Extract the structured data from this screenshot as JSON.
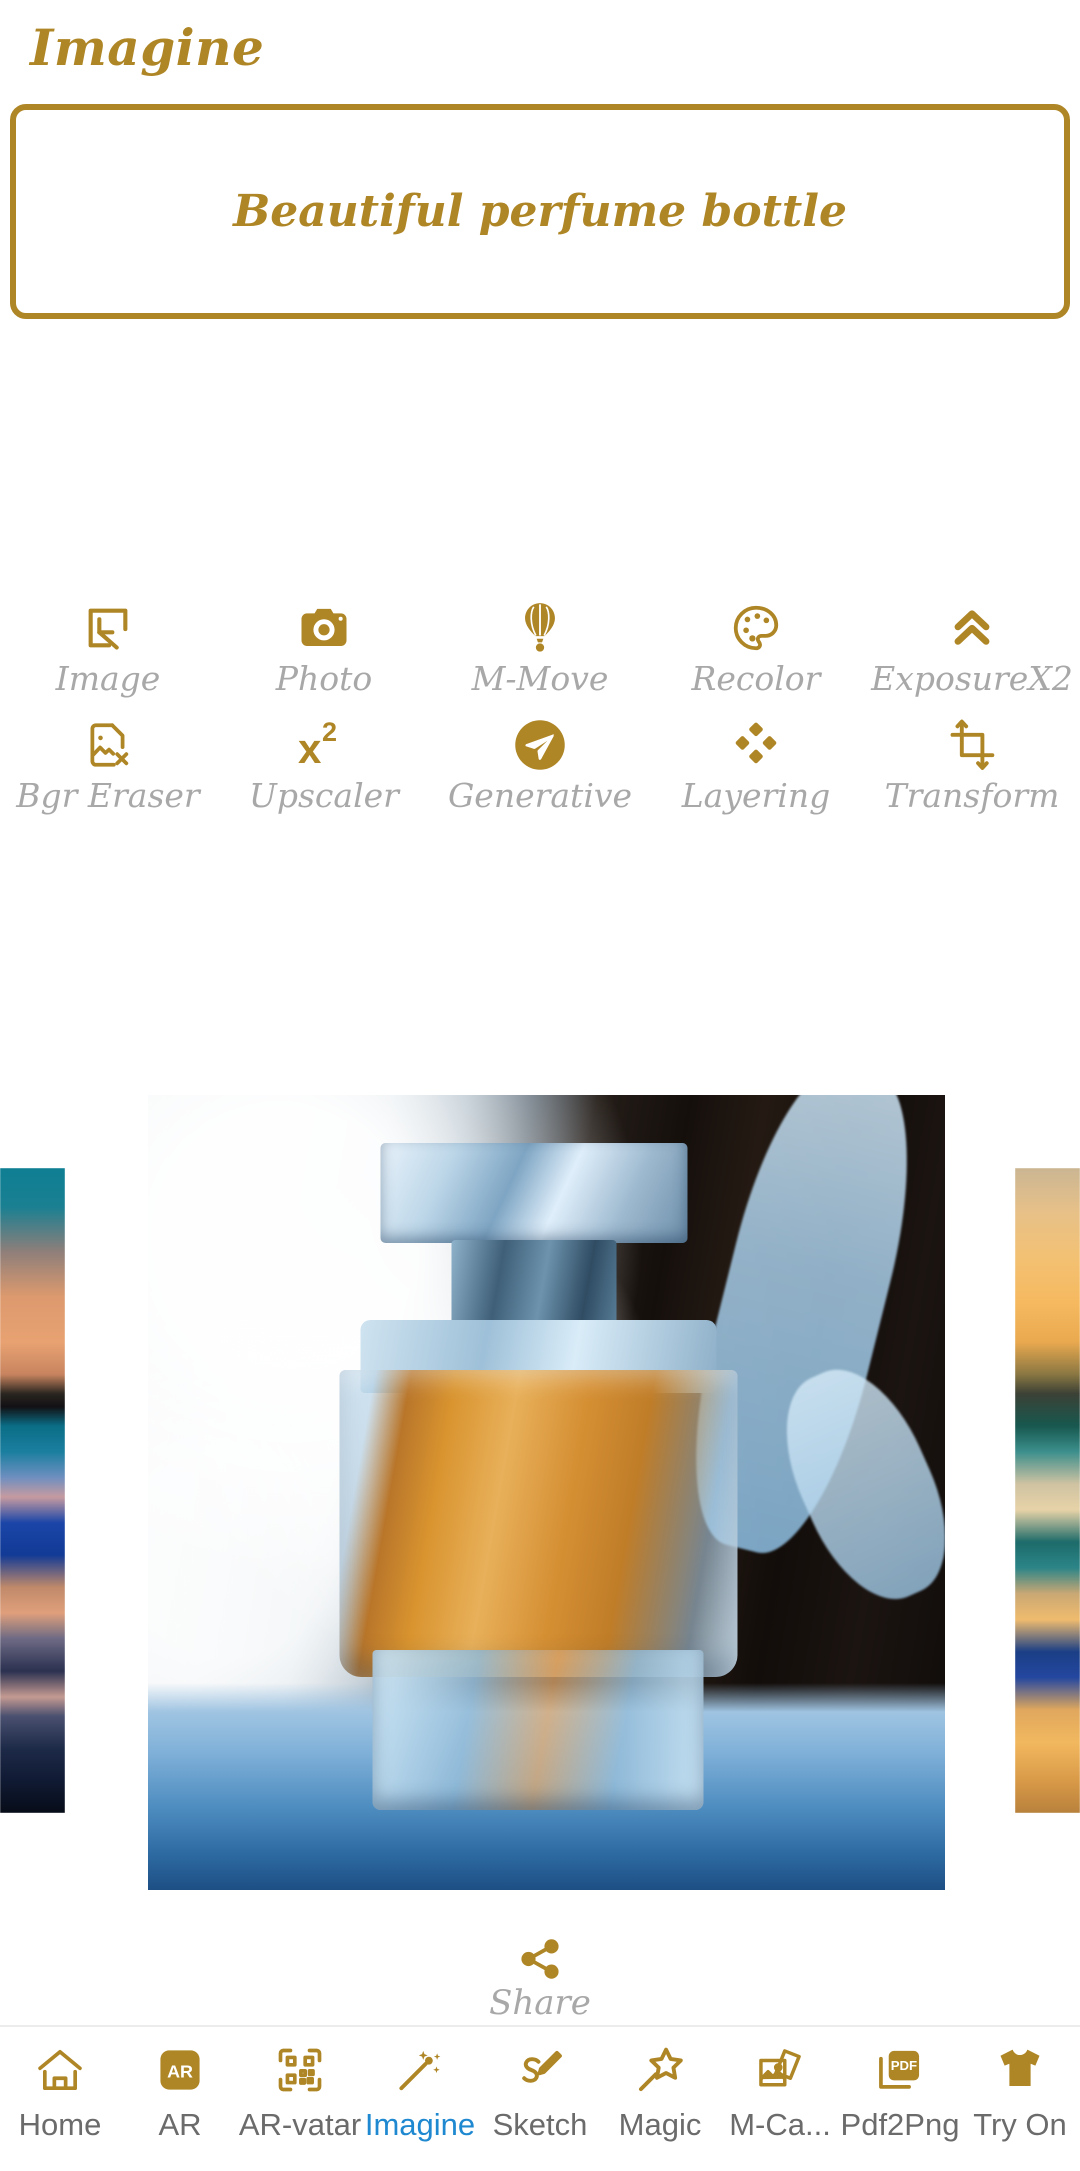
{
  "header": {
    "title": "Imagine"
  },
  "prompt": {
    "value": "Beautiful perfume bottle",
    "placeholder": "Beautiful perfume bottle"
  },
  "colors": {
    "gold": "#AF8626",
    "label_gray": "#A8A8A8",
    "nav_gray": "#6B6B6B",
    "active_blue": "#1E88D0"
  },
  "tools": {
    "row1": [
      {
        "label": "Image",
        "icon": "image-select-icon"
      },
      {
        "label": "Photo",
        "icon": "camera-icon"
      },
      {
        "label": "M-Move",
        "icon": "hot-air-balloon-icon"
      },
      {
        "label": "Recolor",
        "icon": "palette-icon"
      },
      {
        "label": "ExposureX2",
        "icon": "double-chevron-up-icon"
      }
    ],
    "row2": [
      {
        "label": "Bgr Eraser",
        "icon": "image-remove-icon"
      },
      {
        "label": "Upscaler",
        "icon": "x-squared-icon"
      },
      {
        "label": "Generative",
        "icon": "send-circle-icon"
      },
      {
        "label": "Layering",
        "icon": "four-diamonds-icon"
      },
      {
        "label": "Transform",
        "icon": "crop-transform-icon"
      }
    ]
  },
  "carousel": {
    "main_alt": "perfume-bottle-in-snow",
    "side_left_alt": "sunset-ocean-thumbnail",
    "side_right_alt": "golden-sunset-beach-thumbnail"
  },
  "share": {
    "label": "Share",
    "icon": "share-icon"
  },
  "bottom_nav": {
    "items": [
      {
        "label": "Home",
        "icon": "home-icon",
        "active": false
      },
      {
        "label": "AR",
        "icon": "ar-badge-icon",
        "active": false
      },
      {
        "label": "AR-vatar",
        "icon": "qr-code-icon",
        "active": false
      },
      {
        "label": "Imagine",
        "icon": "magic-wand-icon",
        "active": true
      },
      {
        "label": "Sketch",
        "icon": "sketch-pen-icon",
        "active": false
      },
      {
        "label": "Magic",
        "icon": "star-wand-icon",
        "active": false
      },
      {
        "label": "M-Ca...",
        "icon": "photo-stack-icon",
        "active": false
      },
      {
        "label": "Pdf2Png",
        "icon": "pdf-file-icon",
        "active": false
      },
      {
        "label": "Try On",
        "icon": "tshirt-icon",
        "active": false
      }
    ]
  }
}
